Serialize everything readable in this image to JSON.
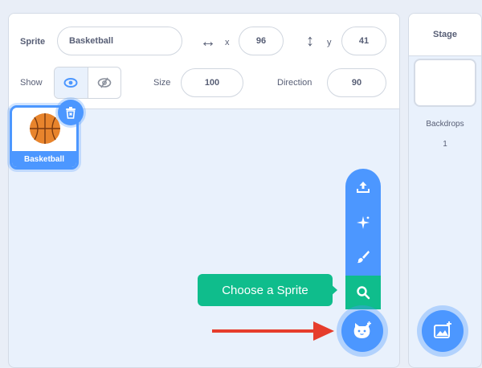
{
  "sprite_info": {
    "sprite_label": "Sprite",
    "sprite_name": "Basketball",
    "x_label": "x",
    "x_value": "96",
    "y_label": "y",
    "y_value": "41",
    "show_label": "Show",
    "size_label": "Size",
    "size_value": "100",
    "direction_label": "Direction",
    "direction_value": "90"
  },
  "sprite_list": [
    {
      "name": "Basketball",
      "selected": true
    }
  ],
  "sprite_menu": {
    "tooltip": "Choose a Sprite",
    "items": [
      "upload-icon",
      "surprise-icon",
      "paint-icon",
      "search-icon"
    ]
  },
  "stage": {
    "title": "Stage",
    "backdrops_label": "Backdrops",
    "backdrops_count": "1"
  },
  "colors": {
    "accent": "#4c97ff",
    "search": "#0fbd8c",
    "annotation_arrow": "#e63d2c",
    "basketball": "#e8842c"
  }
}
